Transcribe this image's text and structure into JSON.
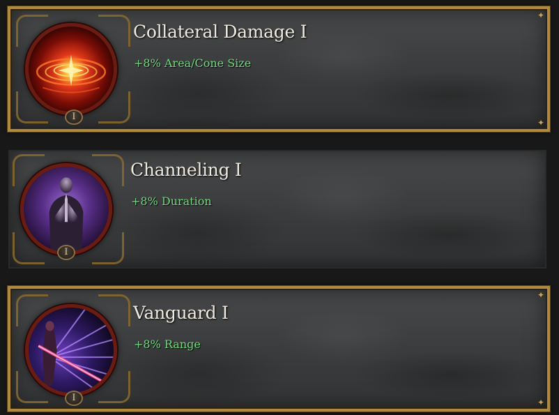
{
  "passives": [
    {
      "title": "Collateral Damage I",
      "bonus": "+8% Area/Cone Size",
      "rank": "I",
      "selected": true,
      "icon": "fire-vortex-icon"
    },
    {
      "title": "Channeling I",
      "bonus": "+8% Duration",
      "rank": "I",
      "selected": false,
      "icon": "praying-figure-icon"
    },
    {
      "title": "Vanguard I",
      "bonus": "+8% Range",
      "rank": "I",
      "selected": true,
      "icon": "lance-warrior-icon"
    }
  ],
  "colors": {
    "frame_gold": "#b08a3e",
    "bonus_green": "#6fdc7d",
    "title_text": "#efeae0"
  }
}
